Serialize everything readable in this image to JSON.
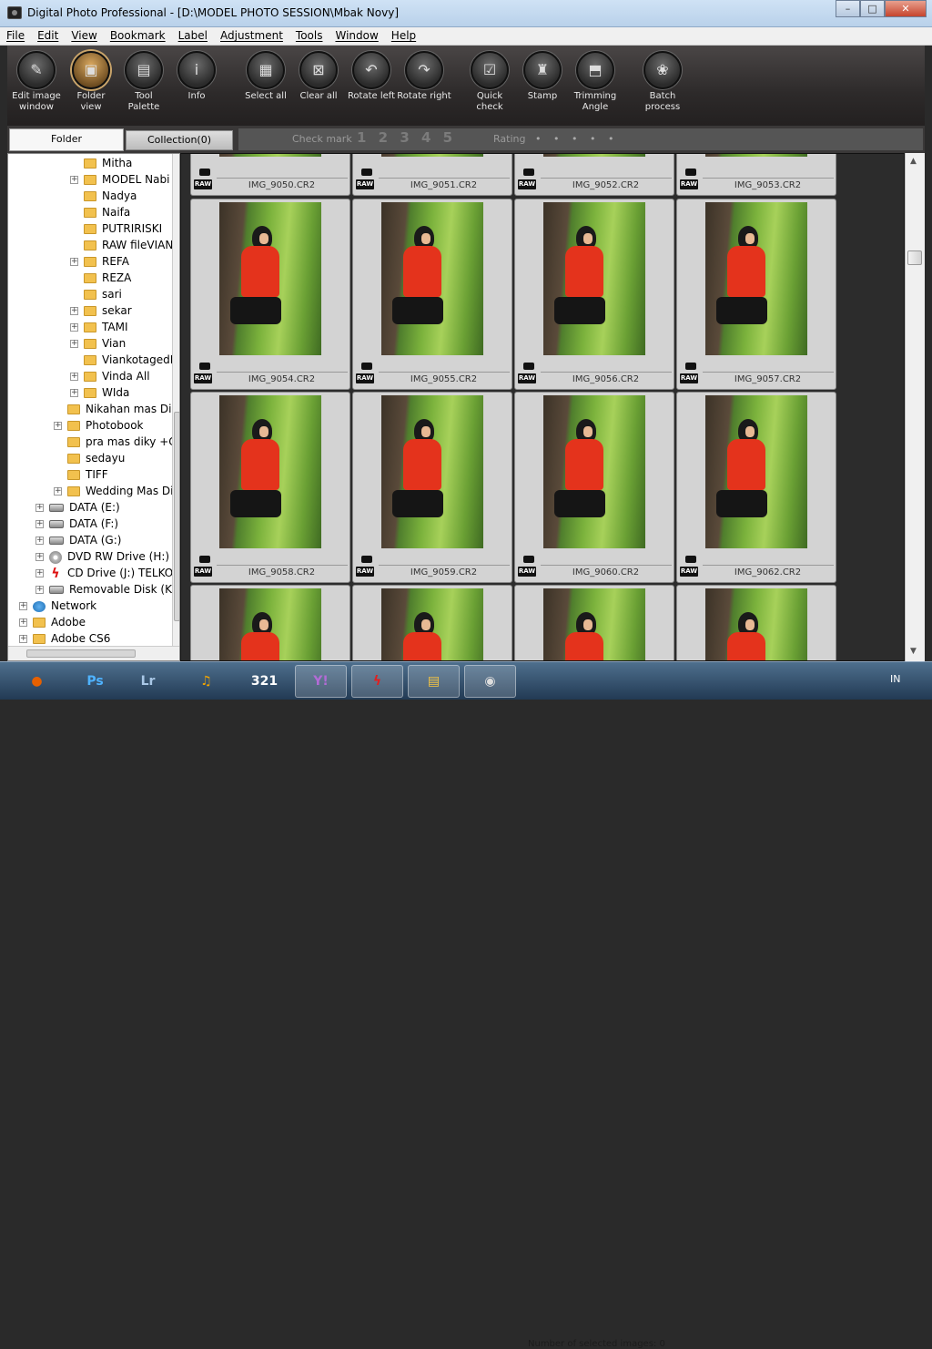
{
  "window": {
    "title": "Digital Photo Professional - [D:\\MODEL PHOTO SESSION\\Mbak Novy]",
    "buttons": {
      "minimize": "–",
      "maximize": "□",
      "close": "✕"
    }
  },
  "menu": [
    "File",
    "Edit",
    "View",
    "Bookmark",
    "Label",
    "Adjustment",
    "Tools",
    "Window",
    "Help"
  ],
  "toolbar": [
    {
      "label1": "Edit image",
      "label2": "window",
      "icon": "edit-image-icon"
    },
    {
      "label1": "Folder",
      "label2": "view",
      "icon": "folder-view-icon",
      "active": true
    },
    {
      "label1": "Tool",
      "label2": "Palette",
      "icon": "tool-palette-icon"
    },
    {
      "label1": "Info",
      "label2": "",
      "icon": "info-icon"
    },
    {
      "label1": "Select all",
      "label2": "",
      "icon": "select-all-icon"
    },
    {
      "label1": "Clear all",
      "label2": "",
      "icon": "clear-all-icon"
    },
    {
      "label1": "Rotate left",
      "label2": "",
      "icon": "rotate-left-icon"
    },
    {
      "label1": "Rotate right",
      "label2": "",
      "icon": "rotate-right-icon"
    },
    {
      "label1": "Quick",
      "label2": "check",
      "icon": "quick-check-icon"
    },
    {
      "label1": "Stamp",
      "label2": "",
      "icon": "stamp-icon"
    },
    {
      "label1": "Trimming",
      "label2": "Angle",
      "icon": "trimming-angle-icon"
    },
    {
      "label1": "Batch",
      "label2": "process",
      "icon": "batch-process-icon"
    }
  ],
  "tabs": {
    "folder": "Folder",
    "collection": "Collection(0)"
  },
  "markbar": {
    "check_mark_label": "Check mark",
    "check_mark_values": "1 2 3 4 5",
    "rating_label": "Rating",
    "rating_dots": "• • • • •"
  },
  "tree": [
    {
      "label": "Mitha",
      "type": "folder",
      "expander": false
    },
    {
      "label": "MODEL Nabi",
      "type": "folder",
      "expander": true
    },
    {
      "label": "Nadya",
      "type": "folder",
      "expander": false
    },
    {
      "label": "Naifa",
      "type": "folder",
      "expander": false
    },
    {
      "label": "PUTRIRISKI",
      "type": "folder",
      "expander": false
    },
    {
      "label": "RAW fileVIAN",
      "type": "folder",
      "expander": false
    },
    {
      "label": "REFA",
      "type": "folder",
      "expander": true
    },
    {
      "label": "REZA",
      "type": "folder",
      "expander": false
    },
    {
      "label": "sari",
      "type": "folder",
      "expander": false
    },
    {
      "label": "sekar",
      "type": "folder",
      "expander": true
    },
    {
      "label": "TAMI",
      "type": "folder",
      "expander": true
    },
    {
      "label": "Vian",
      "type": "folder",
      "expander": true
    },
    {
      "label": "ViankotagedH",
      "type": "folder",
      "expander": false
    },
    {
      "label": "Vinda All",
      "type": "folder",
      "expander": true
    },
    {
      "label": "WIda",
      "type": "folder",
      "expander": true
    },
    {
      "label": "Nikahan mas Dik",
      "type": "folder",
      "expander": false
    },
    {
      "label": "Photobook",
      "type": "folder",
      "expander": true
    },
    {
      "label": "pra mas diky +Cr",
      "type": "folder",
      "expander": false
    },
    {
      "label": "sedayu",
      "type": "folder",
      "expander": false
    },
    {
      "label": "TIFF",
      "type": "folder",
      "expander": false
    },
    {
      "label": "Wedding Mas Di",
      "type": "folder",
      "expander": true
    },
    {
      "label": "DATA (E:)",
      "type": "drive",
      "expander": true
    },
    {
      "label": "DATA (F:)",
      "type": "drive",
      "expander": true
    },
    {
      "label": "DATA (G:)",
      "type": "drive",
      "expander": true
    },
    {
      "label": "DVD RW Drive (H:)",
      "type": "dvd",
      "expander": true
    },
    {
      "label": "CD Drive (J:) TELKOM",
      "type": "cd",
      "expander": true
    },
    {
      "label": "Removable Disk (K:)",
      "type": "drive",
      "expander": true
    },
    {
      "label": "Network",
      "type": "network",
      "expander": true
    },
    {
      "label": "Adobe",
      "type": "folder",
      "expander": true
    },
    {
      "label": "Adobe CS6",
      "type": "folder",
      "expander": true
    }
  ],
  "images_top": [
    "IMG_9050.CR2",
    "IMG_9051.CR2",
    "IMG_9052.CR2",
    "IMG_9053.CR2"
  ],
  "images_row1": [
    "IMG_9054.CR2",
    "IMG_9055.CR2",
    "IMG_9056.CR2",
    "IMG_9057.CR2"
  ],
  "images_row2": [
    "IMG_9058.CR2",
    "IMG_9059.CR2",
    "IMG_9060.CR2",
    "IMG_9062.CR2"
  ],
  "raw_badge": "RAW",
  "taskbar": [
    {
      "name": "firefox-icon",
      "glyph": "●",
      "color": "#e66000"
    },
    {
      "name": "photoshop-icon",
      "glyph": "Ps",
      "color": "#4fb3ff"
    },
    {
      "name": "lightroom-icon",
      "glyph": "Lr",
      "color": "#a9c7e6"
    },
    {
      "name": "headphones-icon",
      "glyph": "♫",
      "color": "#f1a400"
    },
    {
      "name": "calendar-icon",
      "glyph": "321",
      "color": "#fff"
    },
    {
      "name": "yahoo-messenger-icon",
      "glyph": "Y!",
      "color": "#b36bd6"
    },
    {
      "name": "flash-icon",
      "glyph": "ϟ",
      "color": "#e02020"
    },
    {
      "name": "explorer-icon",
      "glyph": "▤",
      "color": "#f5c542"
    },
    {
      "name": "dpp-icon",
      "glyph": "◉",
      "color": "#ddd"
    }
  ],
  "tray": {
    "lang": "IN"
  },
  "status_ghost": "Number of selected images: 0"
}
